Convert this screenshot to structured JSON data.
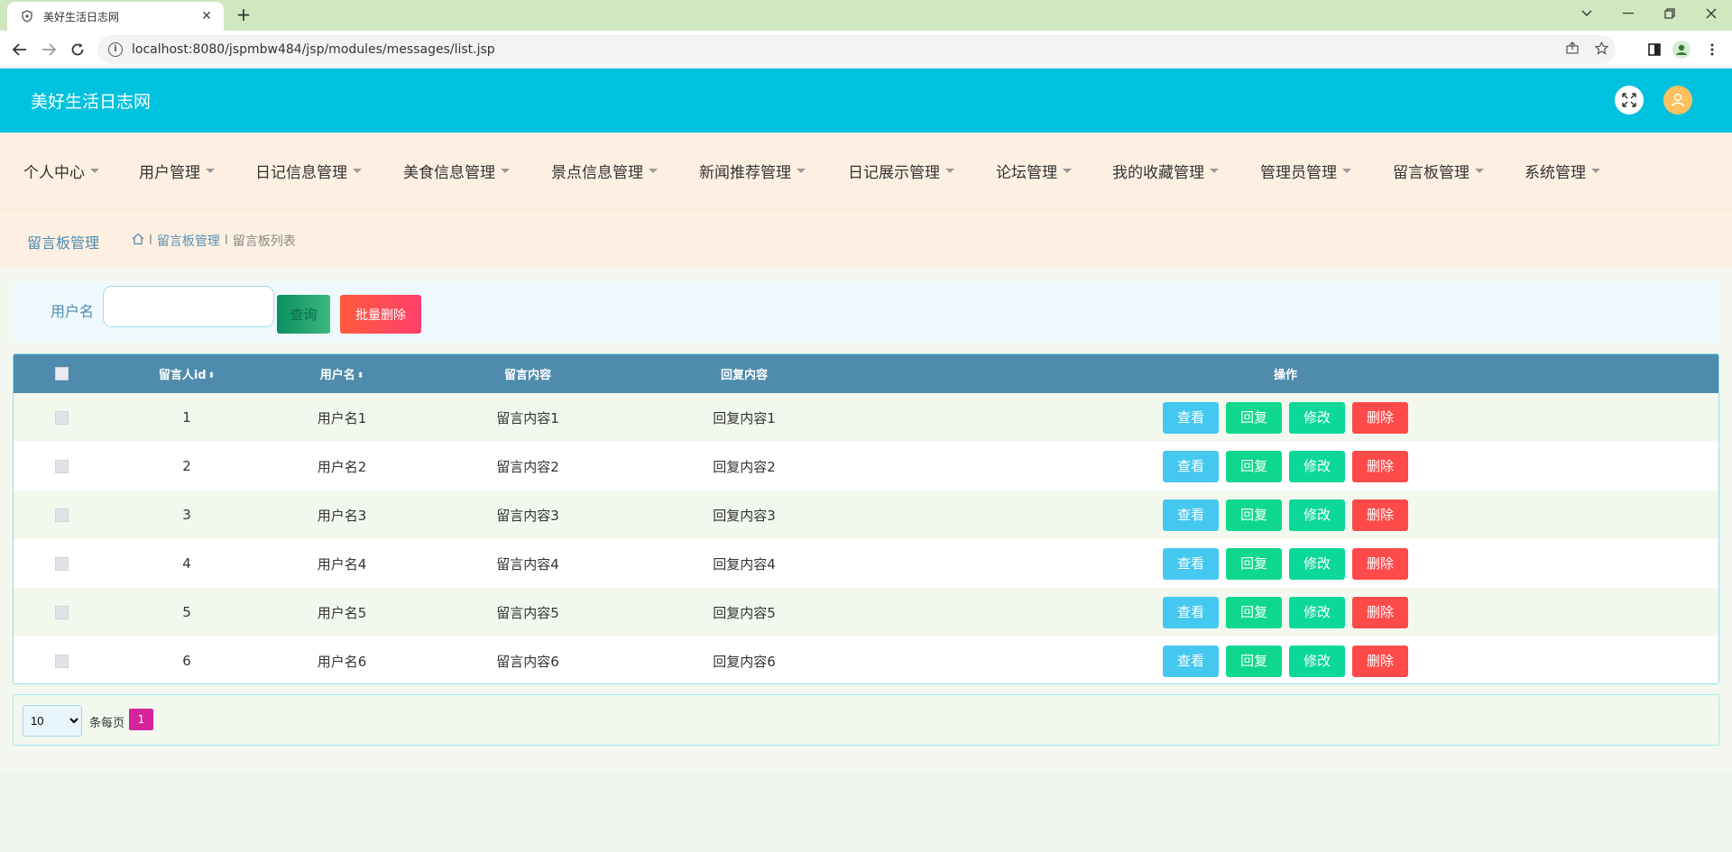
{
  "browser": {
    "tab_title": "美好生活日志网",
    "close_tab": "✕",
    "new_tab": "+",
    "url": "localhost:8080/jspmbw484/jsp/modules/messages/list.jsp"
  },
  "app": {
    "title": "美好生活日志网"
  },
  "menu": [
    "个人中心",
    "用户管理",
    "日记信息管理",
    "美食信息管理",
    "景点信息管理",
    "新闻推荐管理",
    "日记展示管理",
    "论坛管理",
    "我的收藏管理",
    "管理员管理",
    "留言板管理",
    "系统管理"
  ],
  "breadcrumb": {
    "section_title": "留言板管理",
    "sep": "l",
    "level1": "留言板管理",
    "level2": "留言板列表"
  },
  "search": {
    "label": "用户名",
    "value": "",
    "search_button": "查询",
    "batch_delete_button": "批量删除"
  },
  "table": {
    "headers": {
      "user_id": "留言人id",
      "username": "用户名",
      "content": "留言内容",
      "reply": "回复内容",
      "actions": "操作"
    },
    "sort_icon": "⬍",
    "rows": [
      {
        "user_id": "1",
        "username": "用户名1",
        "content": "留言内容1",
        "reply": "回复内容1"
      },
      {
        "user_id": "2",
        "username": "用户名2",
        "content": "留言内容2",
        "reply": "回复内容2"
      },
      {
        "user_id": "3",
        "username": "用户名3",
        "content": "留言内容3",
        "reply": "回复内容3"
      },
      {
        "user_id": "4",
        "username": "用户名4",
        "content": "留言内容4",
        "reply": "回复内容4"
      },
      {
        "user_id": "5",
        "username": "用户名5",
        "content": "留言内容5",
        "reply": "回复内容5"
      },
      {
        "user_id": "6",
        "username": "用户名6",
        "content": "留言内容6",
        "reply": "回复内容6"
      }
    ],
    "action_labels": {
      "view": "查看",
      "reply": "回复",
      "edit": "修改",
      "delete": "删除"
    }
  },
  "pagination": {
    "page_size": "10",
    "per_page_label": "条每页",
    "current_page": "1"
  },
  "colors": {
    "header_bg": "#00c2de",
    "menu_bg": "#fdf0e2",
    "table_header_bg": "#4e8bad",
    "view_btn": "#45c8f0",
    "reply_btn": "#0fd88e",
    "delete_btn": "#ff4a4a",
    "page_active": "#d7239b"
  }
}
